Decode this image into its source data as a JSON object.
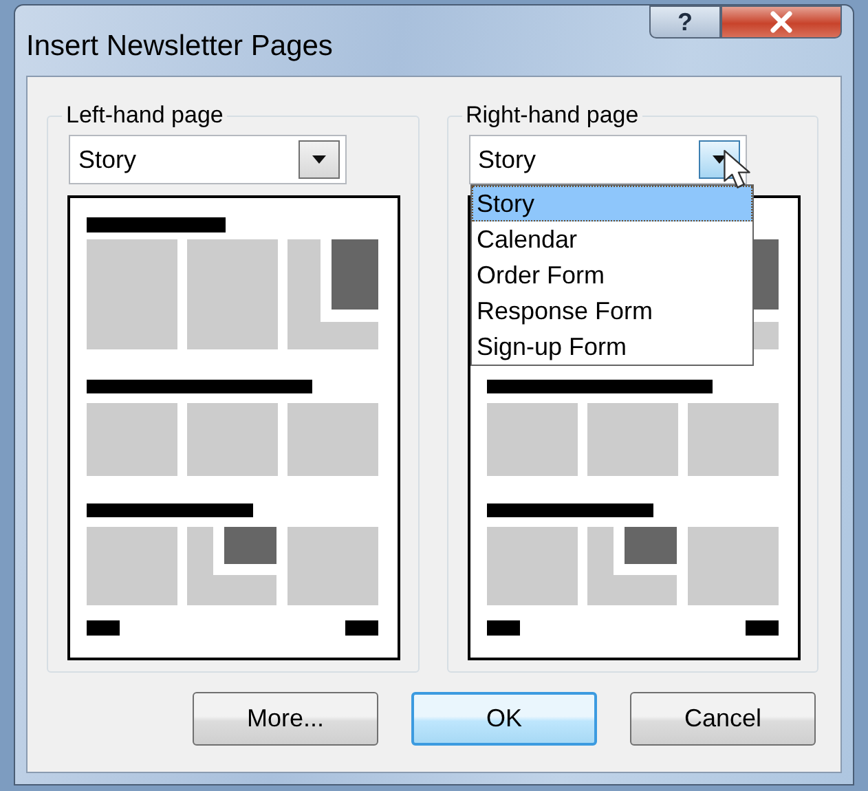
{
  "window": {
    "title": "Insert Newsletter Pages",
    "help_glyph": "?"
  },
  "groups": [
    {
      "label": "Left-hand page",
      "combo": {
        "value": "Story",
        "open": false
      }
    },
    {
      "label": "Right-hand page",
      "combo": {
        "value": "Story",
        "open": true,
        "options": [
          {
            "label": "Story",
            "selected": true
          },
          {
            "label": "Calendar",
            "selected": false
          },
          {
            "label": "Order Form",
            "selected": false
          },
          {
            "label": "Response Form",
            "selected": false
          },
          {
            "label": "Sign-up Form",
            "selected": false
          }
        ]
      }
    }
  ],
  "buttons": [
    {
      "label": "More...",
      "default": false
    },
    {
      "label": "OK",
      "default": true
    },
    {
      "label": "Cancel",
      "default": false
    }
  ]
}
